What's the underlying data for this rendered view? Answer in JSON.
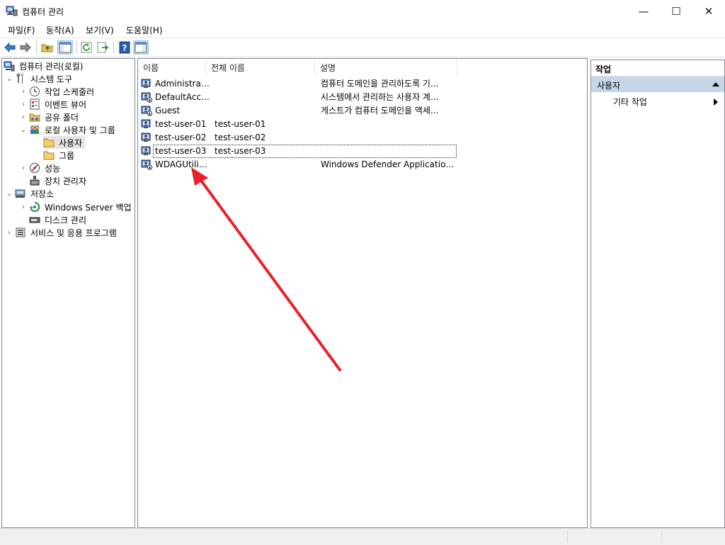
{
  "window": {
    "title": "컴퓨터 관리"
  },
  "window_controls": {
    "minimize": "—",
    "maximize": "☐",
    "close": "✕"
  },
  "menu": [
    "파일(F)",
    "동작(A)",
    "보기(V)",
    "도움말(H)"
  ],
  "toolbar": {
    "buttons": [
      "back-icon",
      "forward-icon",
      "up-folder-icon",
      "show-hide-tree-icon",
      "refresh-icon",
      "export-list-icon",
      "help-icon",
      "show-hide-action-pane-icon"
    ]
  },
  "tree": {
    "root": "컴퓨터 관리(로컬)",
    "system_tools": "시스템 도구",
    "task_scheduler": "작업 스케줄러",
    "event_viewer": "이벤트 뷰어",
    "shared_folders": "공유 폴더",
    "local_users_groups": "로컬 사용자 및 그룹",
    "users": "사용자",
    "groups": "그룹",
    "performance": "성능",
    "device_manager": "장치 관리자",
    "storage": "저장소",
    "windows_server_backup": "Windows Server 백업",
    "disk_management": "디스크 관리",
    "services_apps": "서비스 및 응용 프로그램"
  },
  "list": {
    "columns": [
      "이름",
      "전체 이름",
      "설명"
    ],
    "rows": [
      {
        "name": "Administrator",
        "full_name": "",
        "description": "컴퓨터 도메인을 관리하도록 기..."
      },
      {
        "name": "DefaultAcco...",
        "full_name": "",
        "description": "시스템에서 관리하는 사용자 계..."
      },
      {
        "name": "Guest",
        "full_name": "",
        "description": "게스트가 컴퓨터 도메인을 액세..."
      },
      {
        "name": "test-user-01",
        "full_name": "test-user-01",
        "description": ""
      },
      {
        "name": "test-user-02",
        "full_name": "test-user-02",
        "description": ""
      },
      {
        "name": "test-user-03",
        "full_name": "test-user-03",
        "description": ""
      },
      {
        "name": "WDAGUtility...",
        "full_name": "",
        "description": "Windows Defender Application G..."
      }
    ],
    "focused_row": "test-user-03"
  },
  "actions": {
    "header": "작업",
    "section": "사용자",
    "more_actions": "기타 작업"
  },
  "colors": {
    "selection": "#e5e5e5",
    "action_section": "#c5d6e8",
    "annotation_arrow": "#e8202a"
  }
}
